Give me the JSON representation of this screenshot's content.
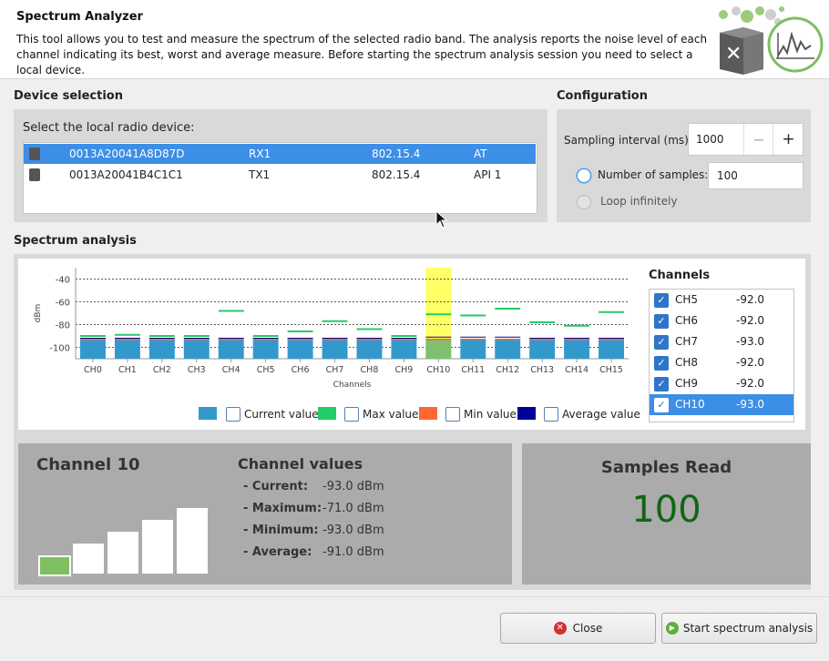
{
  "header": {
    "title": "Spectrum Analyzer",
    "description": "This tool allows you to test and measure the spectrum of the selected radio band. The analysis reports the noise level of each channel indicating its best, worst and average measure. Before starting the spectrum analysis session you need to select a local device."
  },
  "device_selection": {
    "section_title": "Device selection",
    "prompt": "Select the local radio device:",
    "devices": [
      {
        "address": "0013A20041A8D87D",
        "role": "RX1",
        "protocol": "802.15.4",
        "mode": "AT",
        "selected": true
      },
      {
        "address": "0013A20041B4C1C1",
        "role": "TX1",
        "protocol": "802.15.4",
        "mode": "API 1",
        "selected": false
      }
    ]
  },
  "configuration": {
    "section_title": "Configuration",
    "sampling_label": "Sampling interval (ms):",
    "sampling_value": "1000",
    "minus": "−",
    "plus": "+",
    "samples_label": "Number of samples:",
    "samples_value": "100",
    "loop_label": "Loop infinitely"
  },
  "spectrum": {
    "section_title": "Spectrum analysis",
    "channels_title": "Channels",
    "channel_list": [
      {
        "name": "CH5",
        "value": "-92.0",
        "checked": true,
        "selected": false
      },
      {
        "name": "CH6",
        "value": "-92.0",
        "checked": true,
        "selected": false
      },
      {
        "name": "CH7",
        "value": "-93.0",
        "checked": true,
        "selected": false
      },
      {
        "name": "CH8",
        "value": "-92.0",
        "checked": true,
        "selected": false
      },
      {
        "name": "CH9",
        "value": "-92.0",
        "checked": true,
        "selected": false
      },
      {
        "name": "CH10",
        "value": "-93.0",
        "checked": true,
        "selected": true
      }
    ],
    "legend": {
      "current": "Current value",
      "max": "Max value",
      "min": "Min value",
      "average": "Average value"
    }
  },
  "chart_data": {
    "type": "bar",
    "ylabel": "dBm",
    "xlabel": "Channels",
    "yticks": [
      "-40",
      "-60",
      "-80",
      "-100"
    ],
    "ylim": [
      -110,
      -30
    ],
    "categories": [
      "CH0",
      "CH1",
      "CH2",
      "CH3",
      "CH4",
      "CH5",
      "CH6",
      "CH7",
      "CH8",
      "CH9",
      "CH10",
      "CH11",
      "CH12",
      "CH13",
      "CH14",
      "CH15"
    ],
    "highlighted": "CH10",
    "series": [
      {
        "name": "Current value",
        "values": [
          -93,
          -93,
          -93,
          -93,
          -93,
          -92,
          -92,
          -93,
          -92,
          -92,
          -93,
          -93,
          -93,
          -93,
          -93,
          -93
        ]
      },
      {
        "name": "Max value",
        "values": [
          -90,
          -89,
          -90,
          -90,
          -68,
          -90,
          -86,
          -77,
          -84,
          -90,
          -71,
          -72,
          -66,
          -78,
          -81,
          -69
        ]
      },
      {
        "name": "Min value",
        "values": [
          -93,
          -93,
          -93,
          -93,
          -93,
          -93,
          -93,
          -93,
          -93,
          -93,
          -93,
          -93,
          -93,
          -93,
          -93,
          -93
        ]
      },
      {
        "name": "Average value",
        "values": [
          -92,
          -92,
          -92,
          -92,
          -92,
          -92,
          -92,
          -92,
          -92,
          -92,
          -91,
          -91,
          -91,
          -92,
          -92,
          -92
        ]
      }
    ],
    "colors": {
      "current": "#3399cc",
      "max": "#22cc66",
      "min": "#ff6633",
      "average": "#000099",
      "highlight": "#ffff66",
      "highlight_bar": "#7fbf6f"
    }
  },
  "channel_detail": {
    "title": "Channel 10",
    "values_title": "Channel values",
    "rows": [
      {
        "label": "- Current:",
        "value": "-93.0 dBm"
      },
      {
        "label": "- Maximum:",
        "value": "-71.0 dBm"
      },
      {
        "label": "- Minimum:",
        "value": "-93.0 dBm"
      },
      {
        "label": "- Average:",
        "value": "-91.0 dBm"
      }
    ],
    "signal_level": 1,
    "signal_levels_total": 5
  },
  "samples": {
    "title": "Samples Read",
    "count": "100"
  },
  "footer": {
    "close_label": "Close",
    "start_label": "Start spectrum analysis"
  }
}
